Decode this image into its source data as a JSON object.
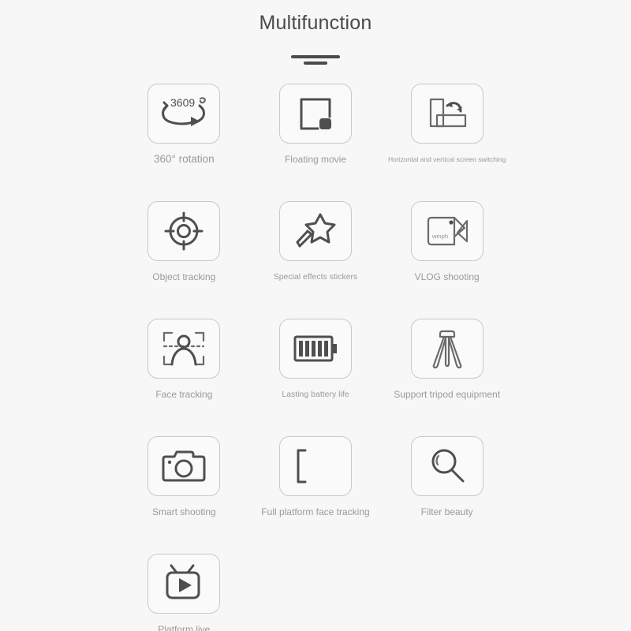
{
  "header": {
    "title": "Multifunction",
    "divider": "double-bar"
  },
  "features": [
    {
      "id": "rotation-360",
      "icon": "rotation-360-icon",
      "icon_text": "3609",
      "label": "360° rotation",
      "label_size": "lbl-lg"
    },
    {
      "id": "floating-movie",
      "icon": "picture-in-picture-icon",
      "label": "Floating movie",
      "label_size": "lbl-md"
    },
    {
      "id": "screen-switching",
      "icon": "screen-rotate-icon",
      "label": "Horizontal and vertical screen switching",
      "label_size": "lbl-xs"
    },
    {
      "id": "object-tracking",
      "icon": "crosshair-target-icon",
      "label": "Object tracking",
      "label_size": "lbl-md"
    },
    {
      "id": "special-effects",
      "icon": "magic-wand-star-icon",
      "label": "Special effects stickers",
      "label_size": "lbl-sm"
    },
    {
      "id": "vlog-shooting",
      "icon": "video-camera-icon",
      "icon_text": "wmph",
      "label": "VLOG shooting",
      "label_size": "lbl-md"
    },
    {
      "id": "face-tracking",
      "icon": "face-focus-frame-icon",
      "label": "Face tracking",
      "label_size": "lbl-md"
    },
    {
      "id": "battery-life",
      "icon": "battery-full-icon",
      "label": "Lasting battery life",
      "label_size": "lbl-sm"
    },
    {
      "id": "tripod-support",
      "icon": "tripod-icon",
      "label": "Support tripod equipment",
      "label_size": "lbl-md"
    },
    {
      "id": "smart-shooting",
      "icon": "camera-icon",
      "label": "Smart shooting",
      "label_size": "lbl-md"
    },
    {
      "id": "full-platform-face-tracking",
      "icon": "bracket-left-icon",
      "label": "Full platform face tracking",
      "label_size": "lbl-md"
    },
    {
      "id": "filter-beauty",
      "icon": "magnifier-icon",
      "label": "Filter beauty",
      "label_size": "lbl-md"
    },
    {
      "id": "platform-live",
      "icon": "tv-play-icon",
      "label": "Platform live",
      "label_size": "lbl-md"
    }
  ],
  "colors": {
    "page_background": "#f7f7f7",
    "card_border": "#c9c9c9",
    "card_fill": "#fafafa",
    "icon_stroke": "#4f4f4f",
    "title_text": "#4a4a4a",
    "label_text": "#9a9a9a"
  }
}
